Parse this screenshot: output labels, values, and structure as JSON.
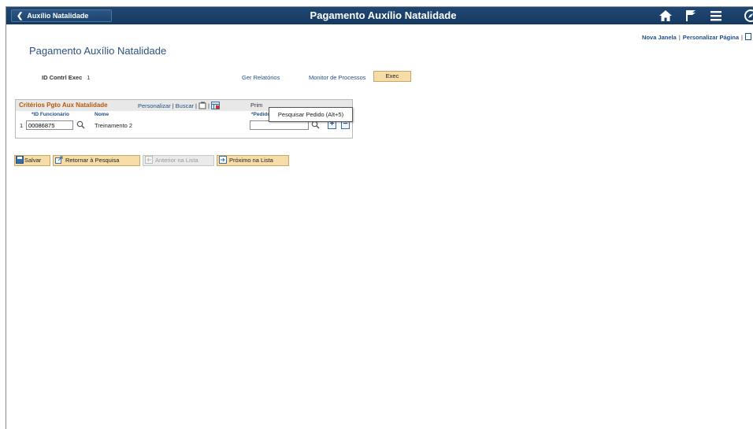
{
  "topbar": {
    "back_label": "Auxílio Natalidade",
    "title": "Pagamento Auxílio Natalidade",
    "icons": [
      "home-icon",
      "flag-icon",
      "menu-icon",
      "navbar-icon"
    ]
  },
  "header_links": {
    "new_window": "Nova Janela",
    "personalize_page": "Personalizar Página",
    "separator": "|"
  },
  "page": {
    "title": "Pagamento Auxílio Natalidade",
    "id_ctrl_label": "ID Contrl Exec",
    "id_ctrl_value": "1",
    "ger_relatorios": "Ger Relatórios",
    "monitor_processos": "Monitor de Processos",
    "exec_label": "Exec"
  },
  "grid": {
    "title": "Critérios Pgto Aux Natalidade",
    "personalize": "Personalizar",
    "search": "Buscar",
    "separator": "|",
    "first_label": "Prim",
    "columns": {
      "id": "*ID Funcionário",
      "name": "Nome",
      "order": "*Pedido"
    },
    "rows": [
      {
        "num": "1",
        "id": "00086875",
        "name": "Treinamento 2",
        "order": ""
      }
    ]
  },
  "tooltip": "Pesquisar Pedido (Alt+5)",
  "toolbar": {
    "save": "Salvar",
    "return_search": "Retornar à Pesquisa",
    "previous": "Anterior na Lista",
    "next": "Próximo na Lista"
  },
  "colors": {
    "topbar": "#1f4774",
    "link": "#1f4f8b",
    "grid_title": "#b5590b",
    "button": "#f6dca6"
  }
}
